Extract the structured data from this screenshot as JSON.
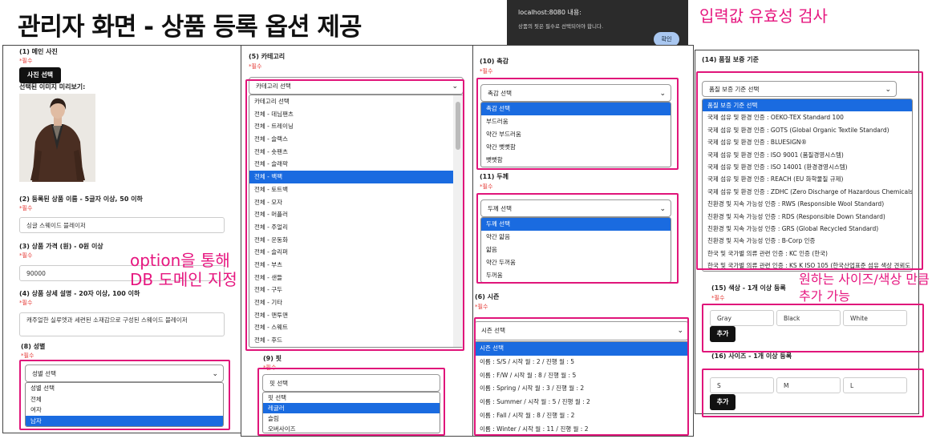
{
  "page_title": "관리자 화면 - 상품 등록 옵션 제공",
  "annotations": {
    "validation": "입력값 유효성 검사",
    "option_db_line1": "option을 통해",
    "option_db_line2": "DB 도메인 지정",
    "add_sizes_line1": "원하는 사이즈/색상 만큼",
    "add_sizes_line2": "추가 가능"
  },
  "alert": {
    "title": "localhost:8080 내용:",
    "message": "상품의 핏은 필수로 선택되어야 합니다.",
    "ok_label": "확인"
  },
  "left_panel": {
    "photo_label": "(1) 메인 사진",
    "photo_required": "*필수",
    "photo_button": "사진 선택",
    "preview_label": "선택된 이미지 미리보기:",
    "name_label": "(2) 등록된 상품 이름 - 5글자 이상, 50 이하",
    "name_required": "*필수",
    "name_value": "싱글 스웨이드 블레이저",
    "price_label": "(3) 상품 가격 (원) - 0원 이상",
    "price_required": "*필수",
    "price_value": "90000",
    "desc_label": "(4) 상품 상세 설명 - 20자 이상, 100 이하",
    "desc_required": "*필수",
    "desc_value": "캐주얼한 실루엣과 세련된 소재감으로 구성된 스웨이드 블레이저",
    "gender_label": "(8) 성별",
    "gender_required": "*필수",
    "gender_select": "성별 선택",
    "gender_options": [
      "성별 선택",
      "전체",
      "여자",
      "남자"
    ],
    "gender_selected_index": 3
  },
  "category_panel": {
    "label": "(5) 카테고리",
    "required": "*필수",
    "select": "카테고리 선택",
    "options": [
      "카테고리 선택",
      "전체 - 데님팬츠",
      "전체 - 트레이닝",
      "전체 - 슬랙스",
      "전체 - 숏팬츠",
      "전체 - 슬래팍",
      "전체 - 백팩",
      "전체 - 토트백",
      "전체 - 모자",
      "전체 - 머플러",
      "전체 - 주얼리",
      "전체 - 운동화",
      "전체 - 슬리퍼",
      "전체 - 부츠",
      "전체 - 샌들",
      "전체 - 구두",
      "전체 - 기타",
      "전체 - 맨투맨",
      "전체 - 스웨트",
      "전체 - 후드"
    ],
    "selected_index": 6,
    "fit_label": "(9) 핏",
    "fit_required": "*필수",
    "fit_select": "핏 선택",
    "fit_options": [
      "핏 선택",
      "레귤러",
      "슬림",
      "오버사이즈"
    ],
    "fit_selected_index": 1
  },
  "middle_panel": {
    "touch_label": "(10) 촉감",
    "touch_required": "*필수",
    "touch_select": "촉감 선택",
    "touch_options": [
      "촉감 선택",
      "부드러움",
      "약간 부드러움",
      "약간 뻣뻣함",
      "뻣뻣함"
    ],
    "touch_selected_index": 0,
    "thick_label": "(11) 두께",
    "thick_required": "*필수",
    "thick_select": "두께 선택",
    "thick_options": [
      "두께 선택",
      "약간 얇음",
      "얇음",
      "약간 두꺼움",
      "두꺼움"
    ],
    "thick_selected_index": 0,
    "season_label": "(6) 시즌",
    "season_required": "*필수",
    "season_select": "시즌 선택",
    "season_options": [
      "시즌 선택",
      "이름 : S/S / 시작 월 : 2 / 진행 월 : 5",
      "이름 : F/W / 시작 월 : 8 / 진행 월 : 5",
      "이름 : Spring / 시작 월 : 3 / 진행 월 : 2",
      "이름 : Summer / 시작 월 : 5 / 진행 월 : 2",
      "이름 : Fall / 시작 월 : 8 / 진행 월 : 2",
      "이름 : Winter / 시작 월 : 11 / 진행 월 : 2"
    ],
    "season_selected_index": 0
  },
  "right_panel": {
    "quality_label": "(14) 품질 보증 기준",
    "quality_select": "품질 보증 기준 선택",
    "quality_options": [
      "품질 보증 기준 선택",
      "국제 섬유 및 환경 인증 : OEKO-TEX Standard 100",
      "국제 섬유 및 환경 인증 : GOTS (Global Organic Textile Standard)",
      "국제 섬유 및 환경 인증 : BLUESIGN®",
      "국제 섬유 및 환경 인증 : ISO 9001 (품질경영시스템)",
      "국제 섬유 및 환경 인증 : ISO 14001 (환경경영시스템)",
      "국제 섬유 및 환경 인증 : REACH (EU 화학물질 규제)",
      "국제 섬유 및 환경 인증 : ZDHC (Zero Discharge of Hazardous Chemicals)",
      "친환경 및 지속 가능성 인증 : RWS (Responsible Wool Standard)",
      "친환경 및 지속 가능성 인증 : RDS (Responsible Down Standard)",
      "친환경 및 지속 가능성 인증 : GRS (Global Recycled Standard)",
      "친환경 및 지속 가능성 인증 : B-Corp 인증",
      "한국 및 국가별 의류 관련 인증 : KC 인증 (한국)",
      "한국 및 국가별 의류 관련 인증 : KS K ISO 105 (한국산업표준 섬유 색상 견뢰도 시험법)"
    ],
    "quality_selected_index": 0,
    "color_label": "(15) 색상 - 1개 이상 등록",
    "color_required": "*필수",
    "colors": [
      "Gray",
      "Black",
      "White"
    ],
    "color_add": "추가",
    "size_label": "(16) 사이즈 - 1개 이상 등록",
    "sizes": [
      "S",
      "M",
      "L"
    ],
    "size_add": "추가"
  }
}
